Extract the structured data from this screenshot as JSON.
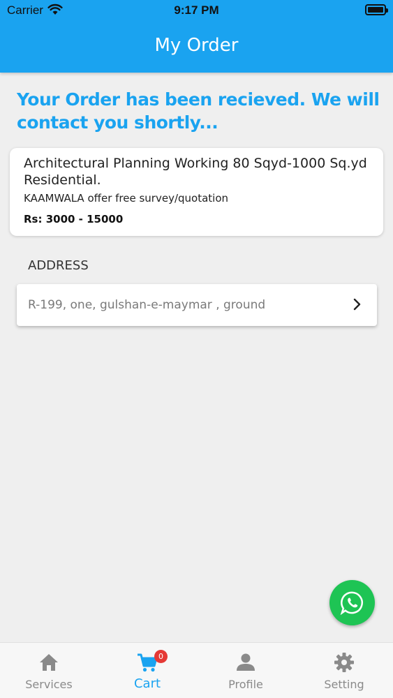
{
  "status_bar": {
    "carrier": "Carrier",
    "time": "9:17 PM"
  },
  "header": {
    "title": "My Order"
  },
  "confirmation": "Your Order has been recieved. We will contact you shortly...",
  "order": {
    "service_name": "Architectural Planning Working 80 Sqyd-1000 Sq.yd Residential.",
    "offer": "KAAMWALA offer free survey/quotation",
    "price": "Rs: 3000 - 15000"
  },
  "address": {
    "label": "ADDRESS",
    "value": "R-199, one, gulshan-e-maymar , ground"
  },
  "tabs": [
    {
      "label": "Services",
      "icon": "home-icon"
    },
    {
      "label": "Cart",
      "icon": "cart-icon",
      "badge": "0"
    },
    {
      "label": "Profile",
      "icon": "person-icon"
    },
    {
      "label": "Setting",
      "icon": "gear-icon"
    }
  ],
  "colors": {
    "primary": "#1aa3f0",
    "whatsapp": "#1ec454",
    "badge": "#e53935"
  }
}
